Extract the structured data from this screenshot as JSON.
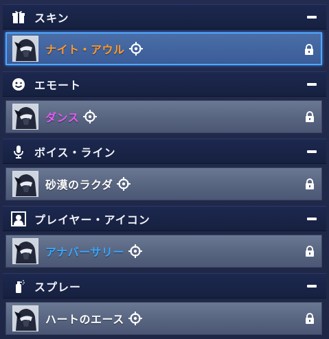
{
  "colors": {
    "selected_border": "#4fa8ff",
    "legendary_orange": "#ff9a2e",
    "epic_purple": "#e25cf5",
    "rare_blue": "#39a8ff",
    "common_white": "#ffffff"
  },
  "sections": [
    {
      "title": "スキン",
      "icon": "gift-icon",
      "item": {
        "name": "ナイト・アウル",
        "rarity_color": "#ff9a2e",
        "selected": true
      }
    },
    {
      "title": "エモート",
      "icon": "smiley-icon",
      "item": {
        "name": "ダンス",
        "rarity_color": "#e25cf5",
        "selected": false
      }
    },
    {
      "title": "ボイス・ライン",
      "icon": "microphone-icon",
      "item": {
        "name": "砂漠のラクダ",
        "rarity_color": "#ffffff",
        "selected": false
      }
    },
    {
      "title": "プレイヤー・アイコン",
      "icon": "player-icon",
      "item": {
        "name": "アナバーサリー",
        "rarity_color": "#39a8ff",
        "selected": false
      }
    },
    {
      "title": "スプレー",
      "icon": "spray-can-icon",
      "item": {
        "name": "ハートのエース",
        "rarity_color": "#ffffff",
        "selected": false
      }
    }
  ]
}
